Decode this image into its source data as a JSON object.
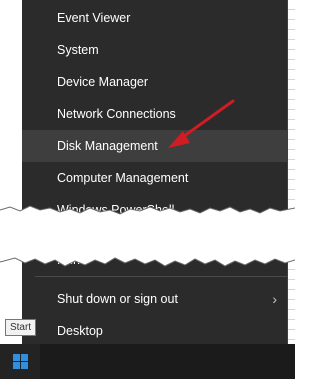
{
  "menu": {
    "items": [
      {
        "label": "Event Viewer"
      },
      {
        "label": "System"
      },
      {
        "label": "Device Manager"
      },
      {
        "label": "Network Connections"
      },
      {
        "label": "Disk Management"
      },
      {
        "label": "Computer Management"
      },
      {
        "label": "Windows PowerShell"
      },
      {
        "label": "Run"
      },
      {
        "label": "Shut down or sign out"
      },
      {
        "label": "Desktop"
      }
    ],
    "submenu_indicator": "›"
  },
  "taskbar": {
    "start_tooltip": "Start"
  },
  "colors": {
    "menu_background": "#2b2b2b",
    "highlight": "#3e3e3e",
    "annotation_arrow": "#d01c24",
    "windows_logo": "#2f8fe0"
  },
  "icons": {
    "start": "windows-logo-icon",
    "submenu": "chevron-right-icon",
    "annotation": "red-arrow"
  }
}
